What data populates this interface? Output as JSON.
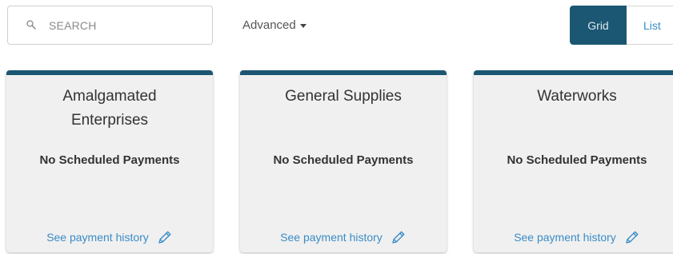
{
  "search": {
    "placeholder": "SEARCH",
    "value": ""
  },
  "filters": {
    "advanced_label": "Advanced"
  },
  "view_toggle": {
    "grid_label": "Grid",
    "list_label": "List",
    "selected": "Grid"
  },
  "cards": [
    {
      "title_line1": "Amalgamated",
      "title_line2": "Enterprises",
      "status": "No Scheduled Payments",
      "link": "See payment history"
    },
    {
      "title_line1": "General Supplies",
      "title_line2": "",
      "status": "No Scheduled Payments",
      "link": "See payment history"
    },
    {
      "title_line1": "Waterworks",
      "title_line2": "",
      "status": "No Scheduled Payments",
      "link": "See payment history"
    }
  ],
  "colors": {
    "accent": "#1b5772",
    "link": "#3a8cc7",
    "card_bg": "#f0f0f0"
  },
  "icons": {
    "search": "search-icon",
    "caret": "caret-down-icon",
    "edit": "pencil-icon"
  }
}
